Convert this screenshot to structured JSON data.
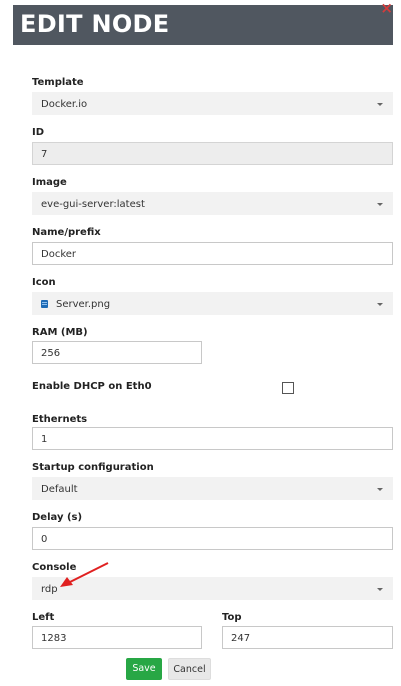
{
  "dialog": {
    "title": "EDIT NODE",
    "close_label": "×"
  },
  "form": {
    "template": {
      "label": "Template",
      "value": "Docker.io"
    },
    "id": {
      "label": "ID",
      "value": "7"
    },
    "image": {
      "label": "Image",
      "value": "eve-gui-server:latest"
    },
    "name_prefix": {
      "label": "Name/prefix",
      "value": "Docker"
    },
    "icon": {
      "label": "Icon",
      "value": "Server.png",
      "icon_name": "server-icon"
    },
    "ram": {
      "label": "RAM (MB)",
      "value": "256"
    },
    "dhcp": {
      "label": "Enable DHCP on Eth0",
      "checked": false
    },
    "ethernets": {
      "label": "Ethernets",
      "value": "1"
    },
    "startup_config": {
      "label": "Startup configuration",
      "value": "Default"
    },
    "delay": {
      "label": "Delay (s)",
      "value": "0"
    },
    "console": {
      "label": "Console",
      "value": "rdp"
    },
    "left": {
      "label": "Left",
      "value": "1283"
    },
    "top": {
      "label": "Top",
      "value": "247"
    }
  },
  "buttons": {
    "save_label": "Save",
    "cancel_label": "Cancel"
  },
  "colors": {
    "header_bg": "#505760",
    "save_bg": "#28a745",
    "annotation_arrow": "#e02020"
  }
}
